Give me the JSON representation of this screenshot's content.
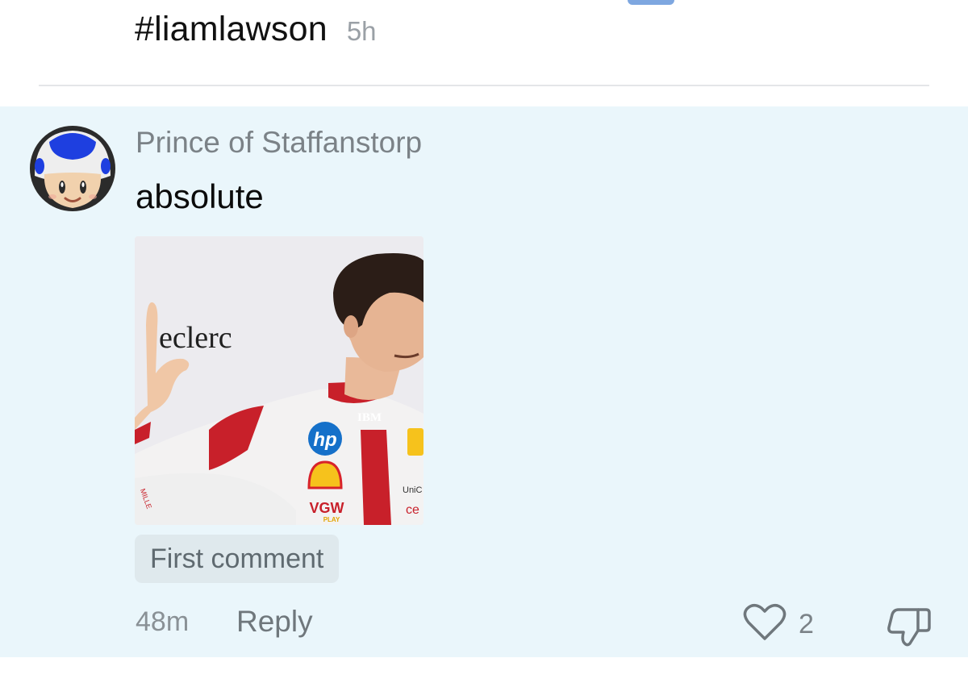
{
  "previous_post": {
    "hashtag": "#liamlawson",
    "age": "5h"
  },
  "comment": {
    "author": "Prince of Staffanstorp",
    "text": "absolute",
    "avatar_icon": "toad-avatar-icon",
    "attachment": {
      "overlay_text": "eclerc",
      "suit_logos": {
        "ibm": "IBM",
        "hp": "hp",
        "vgw": "VGW",
        "vgw_sub": "PLAY",
        "unicredit": "UniC",
        "ceva": "ce",
        "sleeve": "MILLE"
      }
    },
    "badge": "First comment",
    "age": "48m",
    "reply_label": "Reply",
    "like_count": "2",
    "like_icon": "heart-outline-icon",
    "dislike_icon": "thumbs-down-icon"
  },
  "colors": {
    "comment_background": "#eaf6fb",
    "badge_background": "#dfe9ed",
    "muted_text": "#7b8287",
    "avatar_cap": "#1e3fe0",
    "suit_red": "#c8202a"
  }
}
